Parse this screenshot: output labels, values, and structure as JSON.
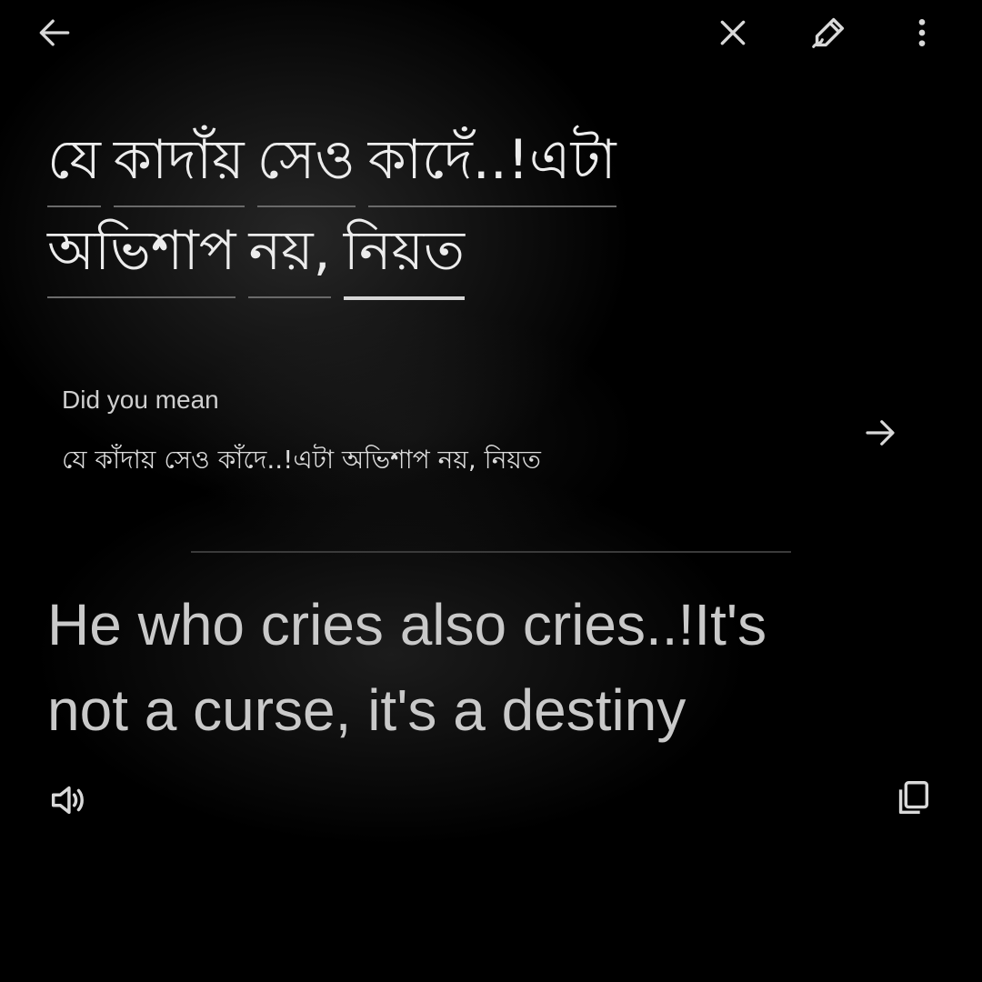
{
  "toolbar": {
    "back_icon": "arrow-left-icon",
    "close_icon": "close-icon",
    "handwrite_icon": "handwriting-pen-icon",
    "more_icon": "more-vert-icon"
  },
  "source": {
    "words": [
      "যে",
      "কাদাঁয়",
      "সেও",
      "কাদেঁ..!এটা",
      "অভিশাপ",
      "নয়,",
      "নিয়ত"
    ]
  },
  "suggestion": {
    "label": "Did you mean",
    "text": "যে কাঁদায় সেও কাঁদে..!এটা অভিশাপ নয়, নিয়ত",
    "arrow_icon": "arrow-right-icon"
  },
  "translation": {
    "line1": "He who cries also cries..!It's",
    "line2": "not a curse, it's a destiny"
  },
  "actions": {
    "speak_icon": "volume-icon",
    "copy_icon": "copy-icon"
  },
  "colors": {
    "background": "#000000",
    "text": "#ececec",
    "translation_text": "#c9c9c9"
  }
}
